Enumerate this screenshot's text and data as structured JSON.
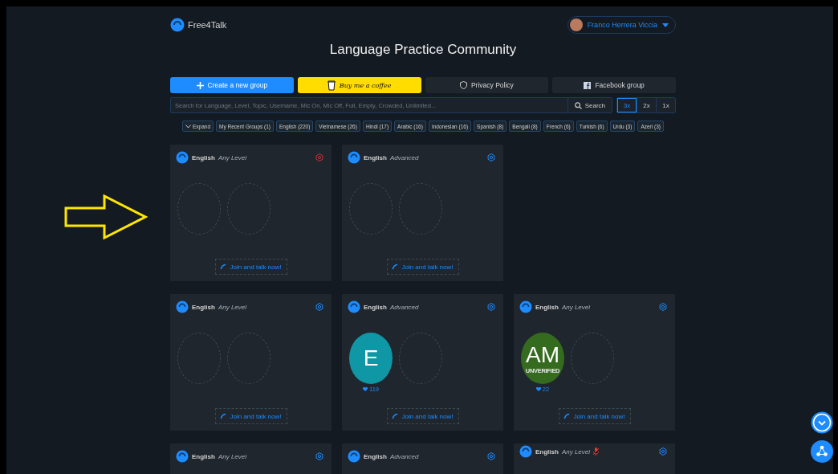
{
  "brand": "Free4Talk",
  "user": {
    "name": "Franco Herrera Viccia"
  },
  "title": "Language Practice Community",
  "actions": [
    {
      "kind": "create",
      "label": "Create a new group"
    },
    {
      "kind": "coffee",
      "label": "Buy me a coffee"
    },
    {
      "kind": "privacy",
      "label": "Privacy Policy"
    },
    {
      "kind": "facebook",
      "label": "Facebook group"
    }
  ],
  "search": {
    "placeholder": "Search for Language, Level, Topic, Username, Mic On, Mic Off, Full, Empty, Crowded, Unlimited...",
    "button": "Search"
  },
  "zoom_options": [
    {
      "label": "3x",
      "selected": true
    },
    {
      "label": "2x",
      "selected": false
    },
    {
      "label": "1x",
      "selected": false
    }
  ],
  "filters": [
    "Expand",
    "My Recent Groups (1)",
    "English (220)",
    "Vietnamese (26)",
    "Hindi (17)",
    "Arabic (16)",
    "Indonesian (16)",
    "Spanish (8)",
    "Bengali (8)",
    "French (6)",
    "Turkish (6)",
    "Urdu (3)",
    "Azeri (3)"
  ],
  "groups": [
    {
      "language": "English",
      "level": "Any Level",
      "alert": true,
      "mic_off": false,
      "join": "Join and talk now!",
      "seats": [
        {
          "kind": "empty"
        },
        {
          "kind": "empty"
        }
      ]
    },
    {
      "language": "English",
      "level": "Advanced",
      "alert": false,
      "mic_off": false,
      "join": "Join and talk now!",
      "seats": [
        {
          "kind": "empty"
        },
        {
          "kind": "empty"
        }
      ]
    },
    {
      "language": "English",
      "level": "Any Level",
      "alert": false,
      "mic_off": false,
      "join": "Join and talk now!",
      "seats": [
        {
          "kind": "empty"
        },
        {
          "kind": "empty"
        }
      ]
    },
    {
      "language": "English",
      "level": "Advanced",
      "alert": false,
      "mic_off": false,
      "join": "Join and talk now!",
      "seats": [
        {
          "kind": "user",
          "initials": "E",
          "color": "#0f97a6",
          "likes": "119"
        },
        {
          "kind": "empty"
        }
      ]
    },
    {
      "language": "English",
      "level": "Any Level",
      "alert": false,
      "mic_off": false,
      "join": "Join and talk now!",
      "seats": [
        {
          "kind": "user",
          "initials": "AM",
          "color": "#346b1f",
          "badge": "UNVERIFIED",
          "likes": "22"
        },
        {
          "kind": "empty"
        }
      ]
    },
    {
      "language": "English",
      "level": "Any Level",
      "alert": false,
      "mic_off": false
    },
    {
      "language": "English",
      "level": "Advanced",
      "alert": false,
      "mic_off": false
    },
    {
      "language": "English",
      "level": "Any Level",
      "alert": false,
      "mic_off": true
    }
  ]
}
